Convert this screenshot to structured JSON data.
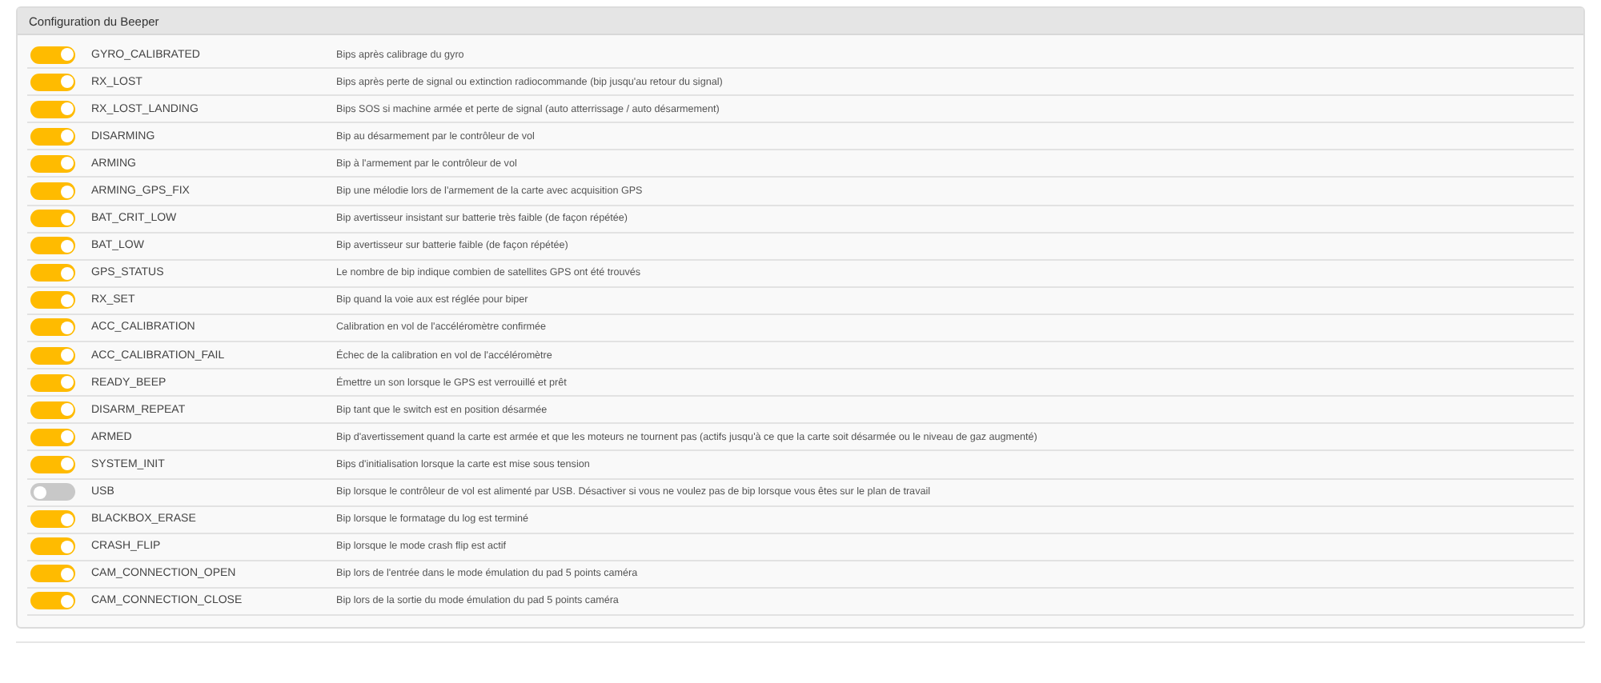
{
  "panel": {
    "title": "Configuration du Beeper"
  },
  "beepers": [
    {
      "name": "GYRO_CALIBRATED",
      "on": true,
      "description": "Bips après calibrage du gyro"
    },
    {
      "name": "RX_LOST",
      "on": true,
      "description": "Bips après perte de signal ou extinction radiocommande (bip jusqu'au retour du signal)"
    },
    {
      "name": "RX_LOST_LANDING",
      "on": true,
      "description": "Bips SOS si machine armée et perte de signal (auto atterrissage / auto désarmement)"
    },
    {
      "name": "DISARMING",
      "on": true,
      "description": "Bip au désarmement par le contrôleur de vol"
    },
    {
      "name": "ARMING",
      "on": true,
      "description": "Bip à l'armement par le contrôleur de vol"
    },
    {
      "name": "ARMING_GPS_FIX",
      "on": true,
      "description": "Bip une mélodie lors de l'armement de la carte avec acquisition GPS"
    },
    {
      "name": "BAT_CRIT_LOW",
      "on": true,
      "description": "Bip avertisseur insistant sur batterie très faible (de façon répétée)"
    },
    {
      "name": "BAT_LOW",
      "on": true,
      "description": "Bip avertisseur sur batterie faible (de façon répétée)"
    },
    {
      "name": "GPS_STATUS",
      "on": true,
      "description": "Le nombre de bip indique combien de satellites GPS ont été trouvés"
    },
    {
      "name": "RX_SET",
      "on": true,
      "description": "Bip quand la voie aux est réglée pour biper"
    },
    {
      "name": "ACC_CALIBRATION",
      "on": true,
      "description": "Calibration en vol de l'accéléromètre confirmée"
    },
    {
      "name": "ACC_CALIBRATION_FAIL",
      "on": true,
      "description": "Échec de la calibration en vol de l'accéléromètre"
    },
    {
      "name": "READY_BEEP",
      "on": true,
      "description": "Émettre un son lorsque le GPS est verrouillé et prêt"
    },
    {
      "name": "DISARM_REPEAT",
      "on": true,
      "description": "Bip tant que le switch est en position désarmée"
    },
    {
      "name": "ARMED",
      "on": true,
      "description": "Bip d'avertissement quand la carte est armée et que les moteurs ne tournent pas (actifs jusqu'à ce que la carte soit désarmée ou le niveau de gaz augmenté)"
    },
    {
      "name": "SYSTEM_INIT",
      "on": true,
      "description": "Bips d'initialisation lorsque la carte est mise sous tension"
    },
    {
      "name": "USB",
      "on": false,
      "description": "Bip lorsque le contrôleur de vol est alimenté par USB. Désactiver si vous ne voulez pas de bip lorsque vous êtes sur le plan de travail"
    },
    {
      "name": "BLACKBOX_ERASE",
      "on": true,
      "description": "Bip lorsque le formatage du log est terminé"
    },
    {
      "name": "CRASH_FLIP",
      "on": true,
      "description": "Bip lorsque le mode crash flip est actif"
    },
    {
      "name": "CAM_CONNECTION_OPEN",
      "on": true,
      "description": "Bip lors de l'entrée dans le mode émulation du pad 5 points caméra"
    },
    {
      "name": "CAM_CONNECTION_CLOSE",
      "on": true,
      "description": "Bip lors de la sortie du mode émulation du pad 5 points caméra"
    }
  ]
}
